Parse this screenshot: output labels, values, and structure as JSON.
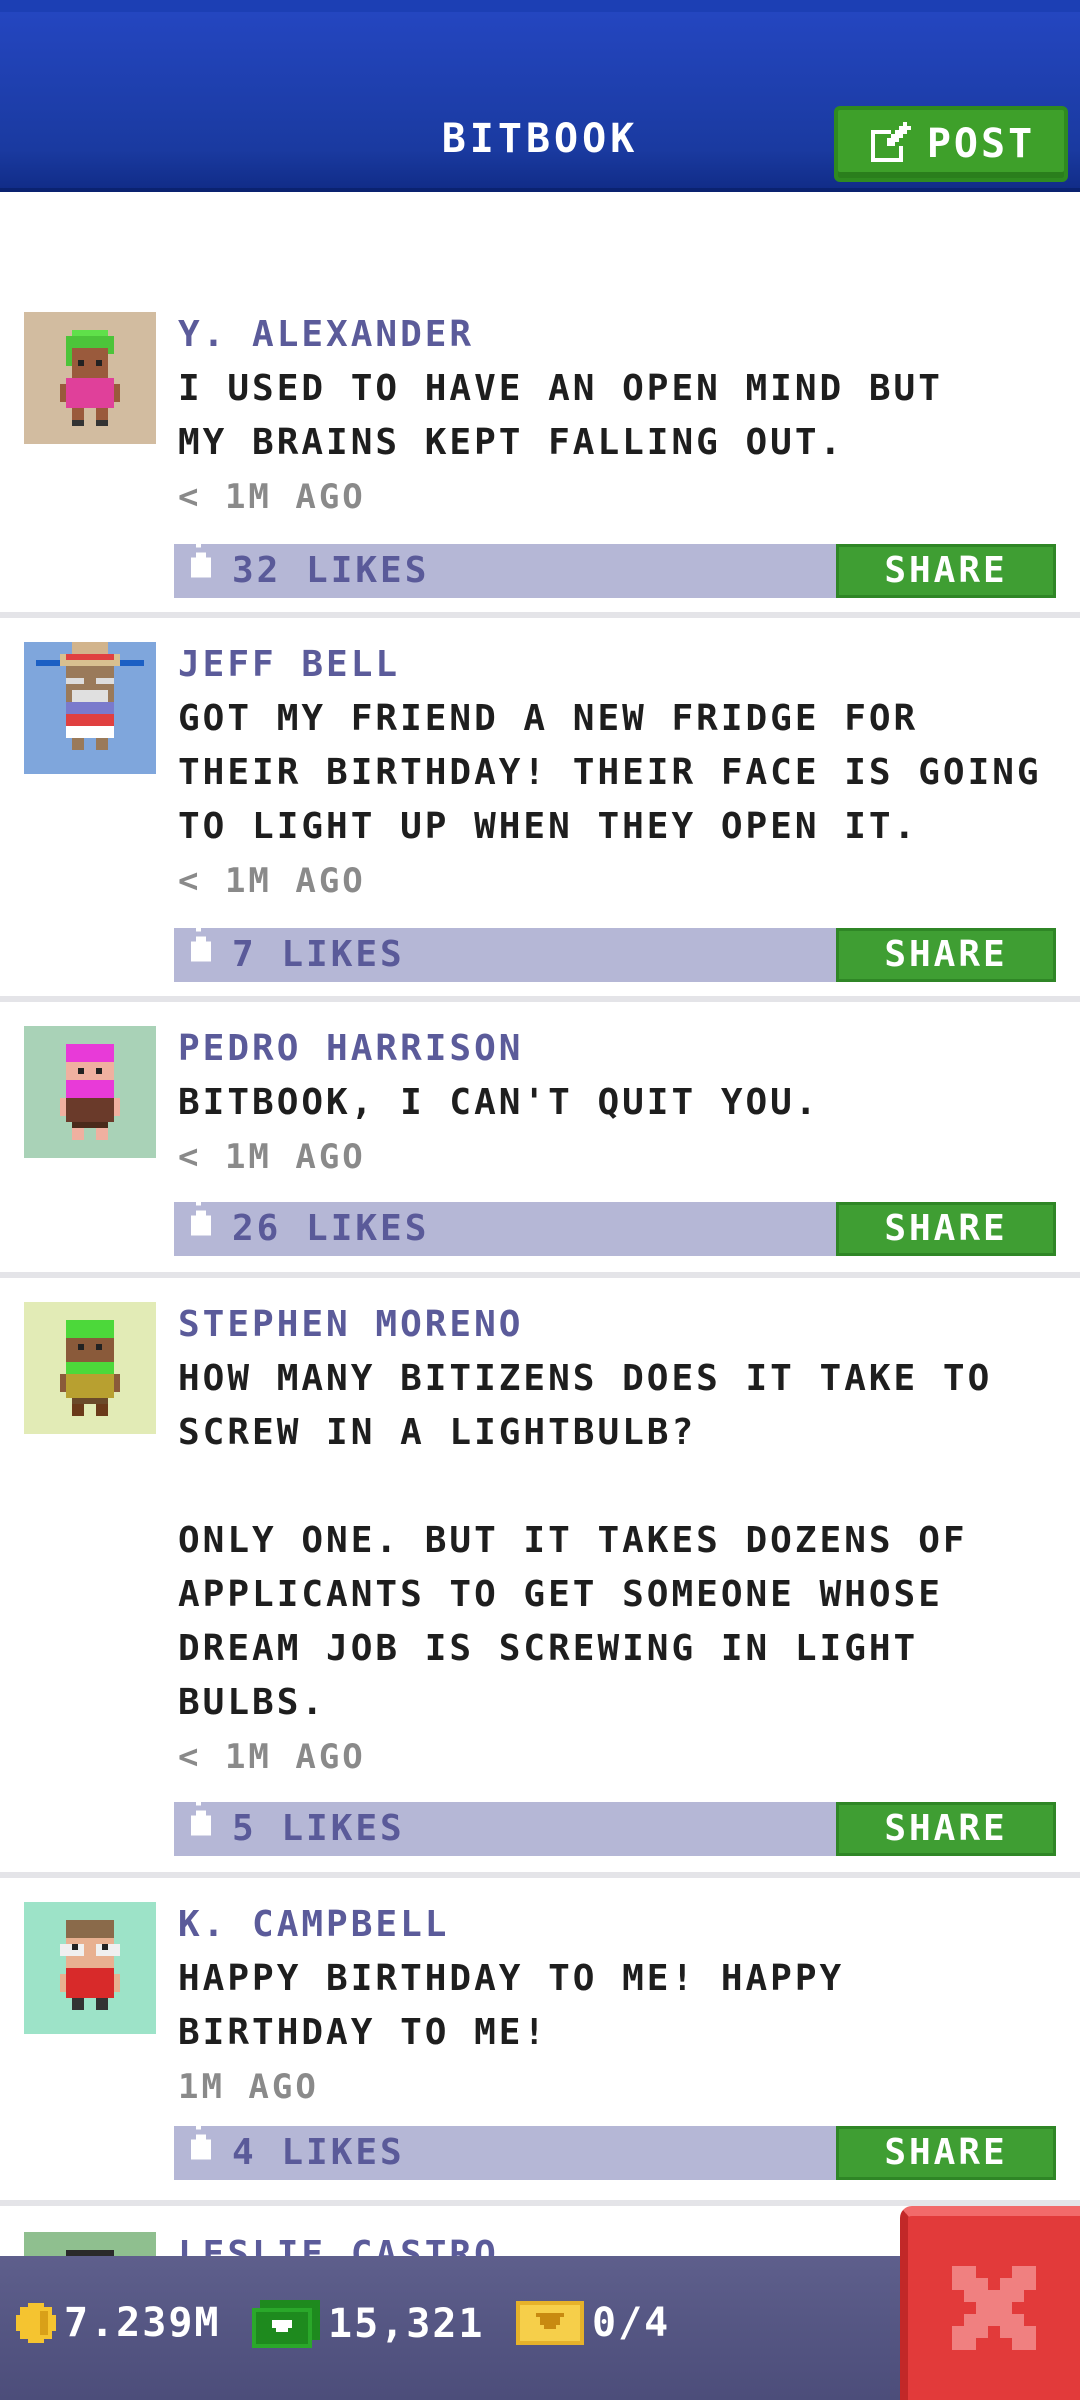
{
  "header": {
    "title": "BITBOOK",
    "post_label": "POST"
  },
  "posts": [
    {
      "author": "Y. ALEXANDER",
      "text": "I USED TO HAVE AN OPEN MIND BUT\nMY BRAINS KEPT FALLING OUT.",
      "time": "< 1M AGO",
      "likes": "32 LIKES",
      "share": "SHARE",
      "avatar_bg": "#d2bca0"
    },
    {
      "author": "JEFF BELL",
      "text": "GOT MY FRIEND A NEW FRIDGE FOR\nTHEIR BIRTHDAY! THEIR FACE IS GOING\nTO LIGHT UP WHEN THEY OPEN IT.",
      "time": "< 1M AGO",
      "likes": "7 LIKES",
      "share": "SHARE",
      "avatar_bg": "#7fa6dc"
    },
    {
      "author": "PEDRO HARRISON",
      "text": "BITBOOK, I CAN'T QUIT YOU.",
      "time": "< 1M AGO",
      "likes": "26 LIKES",
      "share": "SHARE",
      "avatar_bg": "#a9d2b7"
    },
    {
      "author": "STEPHEN MORENO",
      "text": "HOW MANY BITIZENS DOES IT TAKE TO\nSCREW IN A LIGHTBULB?\n\nONLY ONE. BUT IT TAKES DOZENS OF\nAPPLICANTS TO GET SOMEONE WHOSE\nDREAM JOB IS SCREWING IN LIGHT\nBULBS.",
      "time": "< 1M AGO",
      "likes": "5 LIKES",
      "share": "SHARE",
      "avatar_bg": "#e2ebb6"
    },
    {
      "author": "K. CAMPBELL",
      "text": "HAPPY BIRTHDAY TO ME! HAPPY\nBIRTHDAY TO ME!",
      "time": "1M AGO",
      "likes": "4 LIKES",
      "share": "SHARE",
      "avatar_bg": "#9de3c8"
    },
    {
      "author": "LESLIE CASTRO",
      "avatar_bg": "#8fbf8f"
    }
  ],
  "status": {
    "coins": "7.239M",
    "bux": "15,321",
    "tickets": "0/4"
  },
  "colors": {
    "header_blue": "#1a3aa0",
    "post_green": "#3ea02a",
    "likes_bar": "#b5b7d6",
    "author_purple": "#5b5b9a",
    "close_red": "#e23a3a"
  },
  "icons": {
    "post": "edit-icon",
    "like": "thumbs-up-icon",
    "coin": "coin-icon",
    "bux": "bux-icon",
    "ticket": "ticket-icon",
    "close": "close-icon"
  }
}
